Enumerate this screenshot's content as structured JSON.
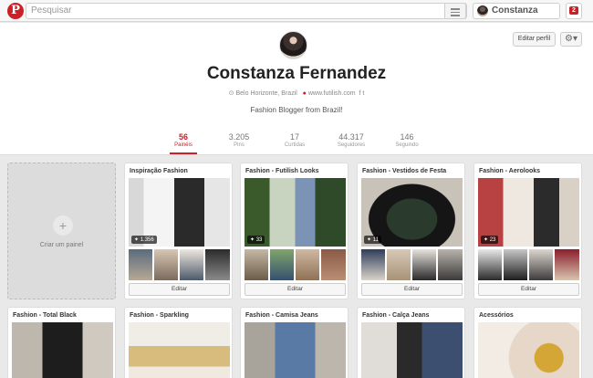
{
  "topbar": {
    "logo": "P",
    "search_placeholder": "Pesquisar",
    "user_name": "Constanza",
    "notifications": "2"
  },
  "profile": {
    "edit_label": "Editar perfil",
    "name": "Constanza Fernandez",
    "location": "Belo Horizonte, Brazil",
    "website": "www.futilish.com",
    "bio": "Fashion Blogger from Brazil!",
    "stats": [
      {
        "num": "56",
        "label": "Painéis"
      },
      {
        "num": "3.205",
        "label": "Pins"
      },
      {
        "num": "17",
        "label": "Curtidas"
      },
      {
        "num": "44.317",
        "label": "Seguidores"
      },
      {
        "num": "146",
        "label": "Seguindo"
      }
    ]
  },
  "create_board": {
    "label": "Criar um painel"
  },
  "boards": [
    {
      "title": "Inspiração Fashion",
      "count": "1.356",
      "edit": "Editar"
    },
    {
      "title": "Fashion - Futilish Looks",
      "count": "33",
      "edit": "Editar"
    },
    {
      "title": "Fashion - Vestidos de Festa",
      "count": "11",
      "edit": "Editar"
    },
    {
      "title": "Fashion - Aerolooks",
      "count": "23",
      "edit": "Editar"
    },
    {
      "title": "Fashion - Total Black"
    },
    {
      "title": "Fashion - Sparkling"
    },
    {
      "title": "Fashion - Camisa Jeans"
    },
    {
      "title": "Fashion - Calça Jeans"
    },
    {
      "title": "Acessórios"
    }
  ],
  "colors": {
    "accent": "#cb2027"
  }
}
